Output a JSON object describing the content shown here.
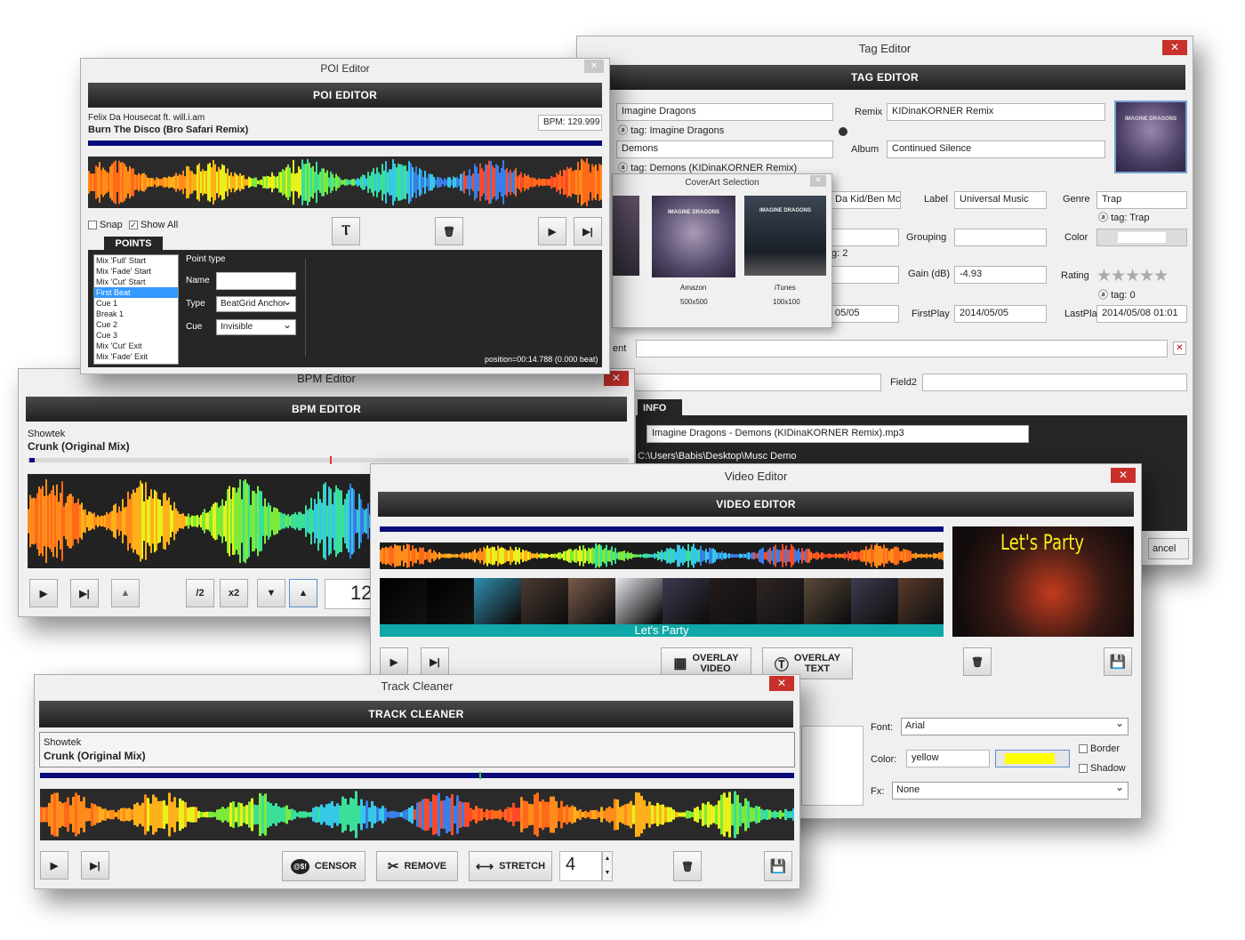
{
  "tag": {
    "title": "Tag Editor",
    "header": "TAG EDITOR",
    "artist": "Imagine Dragons",
    "artist_tag": "tag: Imagine Dragons",
    "title_field": "Demons",
    "title_tag": "tag: Demons (KIDinaKORNER Remix)",
    "remix_label": "Remix",
    "remix": "KIDinaKORNER Remix",
    "album_label": "Album",
    "album": "Continued Silence",
    "composer": "Da Kid/Ben Mck",
    "label_label": "Label",
    "label": "Universal Music",
    "genre_label": "Genre",
    "genre": "Trap",
    "genre_tag": "tag: Trap",
    "grouping_label": "Grouping",
    "color_label": "Color",
    "gain_label": "Gain (dB)",
    "gain": "-4.93",
    "rating_label": "Rating",
    "rating_tag": "tag: 0",
    "rating_stars": 0,
    "tag_two": "g: 2",
    "date_partial": "05/05",
    "firstplay_label": "FirstPlay",
    "firstplay": "2014/05/05",
    "lastplay_label": "LastPlay",
    "lastplay": "2014/05/08 01:01",
    "comment_partial": "ent",
    "field2_label": "Field2",
    "info_tab": "INFO",
    "filename": "Imagine Dragons - Demons (KIDinaKORNER Remix).mp3",
    "path": "C:\\Users\\Babis\\Desktop\\Musc Demo",
    "cancel": "ancel"
  },
  "coverart": {
    "title": "CoverArt Selection",
    "art_text": "IMAGINE DRAGONS",
    "items": [
      {
        "source": "Amazon",
        "size": "500x500"
      },
      {
        "source": "iTunes",
        "size": "100x100"
      }
    ]
  },
  "poi": {
    "title": "POI Editor",
    "header": "POI EDITOR",
    "artist": "Felix Da Housecat ft. will.i.am",
    "track": "Burn The Disco (Bro Safari Remix)",
    "bpm": "BPM: 129.999",
    "snap": "Snap",
    "show_all": "Show All",
    "points_tab": "POINTS",
    "points": [
      "Mix 'Full' Start",
      "Mix 'Fade' Start",
      "Mix 'Cut' Start",
      "First Beat",
      "Cue 1",
      "Break 1",
      "Cue 2",
      "Cue 3",
      "Mix 'Cut' Exit",
      "Mix 'Fade' Exit"
    ],
    "selected_point": "First Beat",
    "point_type_label": "Point type",
    "name_label": "Name",
    "type_label": "Type",
    "type_value": "BeatGrid Anchor",
    "cue_label": "Cue",
    "cue_value": "Invisible",
    "position": "position=00:14.788 (0.000 beat)"
  },
  "bpm": {
    "title": "BPM Editor",
    "header": "BPM EDITOR",
    "artist": "Showtek",
    "track": "Crunk (Original Mix)",
    "half": "/2",
    "double": "x2",
    "value": "12"
  },
  "video": {
    "title": "Video Editor",
    "header": "VIDEO EDITOR",
    "strip_text": "Let's Party",
    "preview_text": "Let's Party",
    "overlay_video_1": "OVERLAY",
    "overlay_video_2": "VIDEO",
    "overlay_text_1": "OVERLAY",
    "overlay_text_2": "TEXT",
    "font_label": "Font:",
    "font": "Arial",
    "color_label": "Color:",
    "color": "yellow",
    "color_swatch": "#ffff00",
    "border": "Border",
    "shadow": "Shadow",
    "fx_label": "Fx:",
    "fx": "None"
  },
  "cleaner": {
    "title": "Track Cleaner",
    "header": "TRACK CLEANER",
    "artist": "Showtek",
    "track": "Crunk (Original Mix)",
    "censor": "CENSOR",
    "censor_icon_text": "@$!",
    "remove": "REMOVE",
    "stretch": "STRETCH",
    "value": "4"
  }
}
